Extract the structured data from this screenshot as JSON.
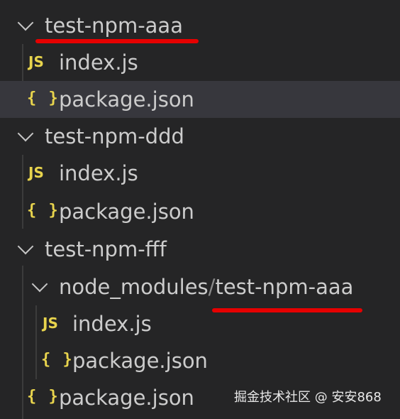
{
  "tree": {
    "folders": [
      {
        "name": "test-npm-aaa"
      },
      {
        "name": "test-npm-ddd"
      },
      {
        "name": "test-npm-fff"
      }
    ],
    "nested_folder": {
      "parent": "node_modules",
      "separator": "/",
      "child": "test-npm-aaa"
    },
    "files": {
      "index_js": "index.js",
      "package_json": "package.json"
    },
    "icons": {
      "js": "JS",
      "json": "{ }"
    },
    "selected_item": "test-npm-aaa/package.json"
  },
  "annotations": {
    "underline_color": "#e60000"
  },
  "watermark": "掘金技术社区 @ 安安868"
}
